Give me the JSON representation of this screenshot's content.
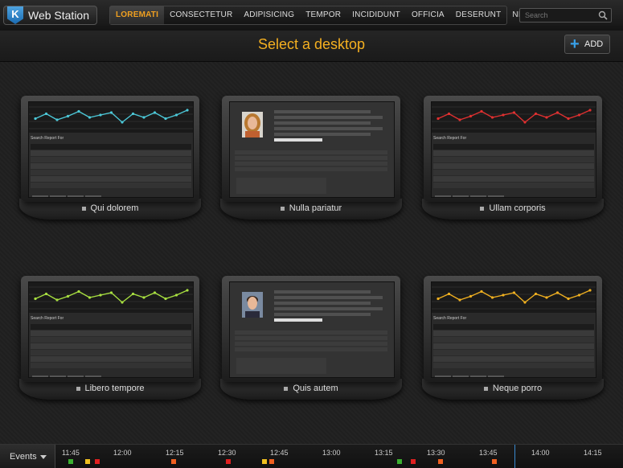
{
  "app": {
    "logo_letter": "K",
    "title": "Web Station"
  },
  "nav": {
    "items": [
      "LOREMATI",
      "CONSECTETUR",
      "ADIPISICING",
      "TEMPOR",
      "INCIDIDUNT",
      "OFFICIA",
      "DESERUNT",
      "NEQUE"
    ],
    "active": "LOREMATI"
  },
  "search": {
    "placeholder": "Search"
  },
  "header": {
    "title": "Select a desktop",
    "add_label": "ADD"
  },
  "desktops": [
    {
      "label": "Qui dolorem",
      "kind": "chart",
      "line_color": "#4cc8d8"
    },
    {
      "label": "Nulla pariatur",
      "kind": "form",
      "avatar": "woman"
    },
    {
      "label": "Ullam corporis",
      "kind": "chart",
      "line_color": "#e03030"
    },
    {
      "label": "Libero tempore",
      "kind": "chart",
      "line_color": "#a8e040"
    },
    {
      "label": "Quis autem",
      "kind": "form",
      "avatar": "man"
    },
    {
      "label": "Neque porro",
      "kind": "chart",
      "line_color": "#f0b020"
    }
  ],
  "screen_text": {
    "search_report": "Search Report For"
  },
  "timeline": {
    "events_label": "Events",
    "times": [
      "11:45",
      "12:00",
      "12:15",
      "12:30",
      "12:45",
      "13:00",
      "13:15",
      "13:30",
      "13:45",
      "14:00",
      "14:15"
    ],
    "colors": {
      "green": "#3cb030",
      "yellow": "#f0c020",
      "red": "#e02020",
      "orange": "#f06020",
      "now": "#3a8ad0"
    }
  }
}
